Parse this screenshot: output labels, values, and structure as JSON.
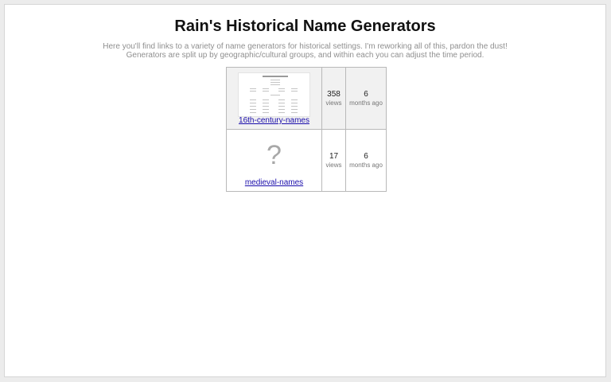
{
  "page": {
    "title": "Rain's Historical Name Generators",
    "intro": [
      "Here you'll find links to a variety of name generators for historical settings. I'm reworking all of this, pardon the dust!",
      "Generators are split up by geographic/cultural groups, and within each you can adjust the time period."
    ]
  },
  "generators": [
    {
      "name": "16th-century-names",
      "thumbnail": "page-preview",
      "views": "358",
      "views_label": "views",
      "age": "6",
      "age_label": "months ago"
    },
    {
      "name": "medieval-names",
      "thumbnail": "?",
      "views": "17",
      "views_label": "views",
      "age": "6",
      "age_label": "months ago"
    }
  ],
  "colors": {
    "link": "#1a0dab",
    "intro_text": "#8f8f8f",
    "row_shaded": "#f1f1f1"
  }
}
